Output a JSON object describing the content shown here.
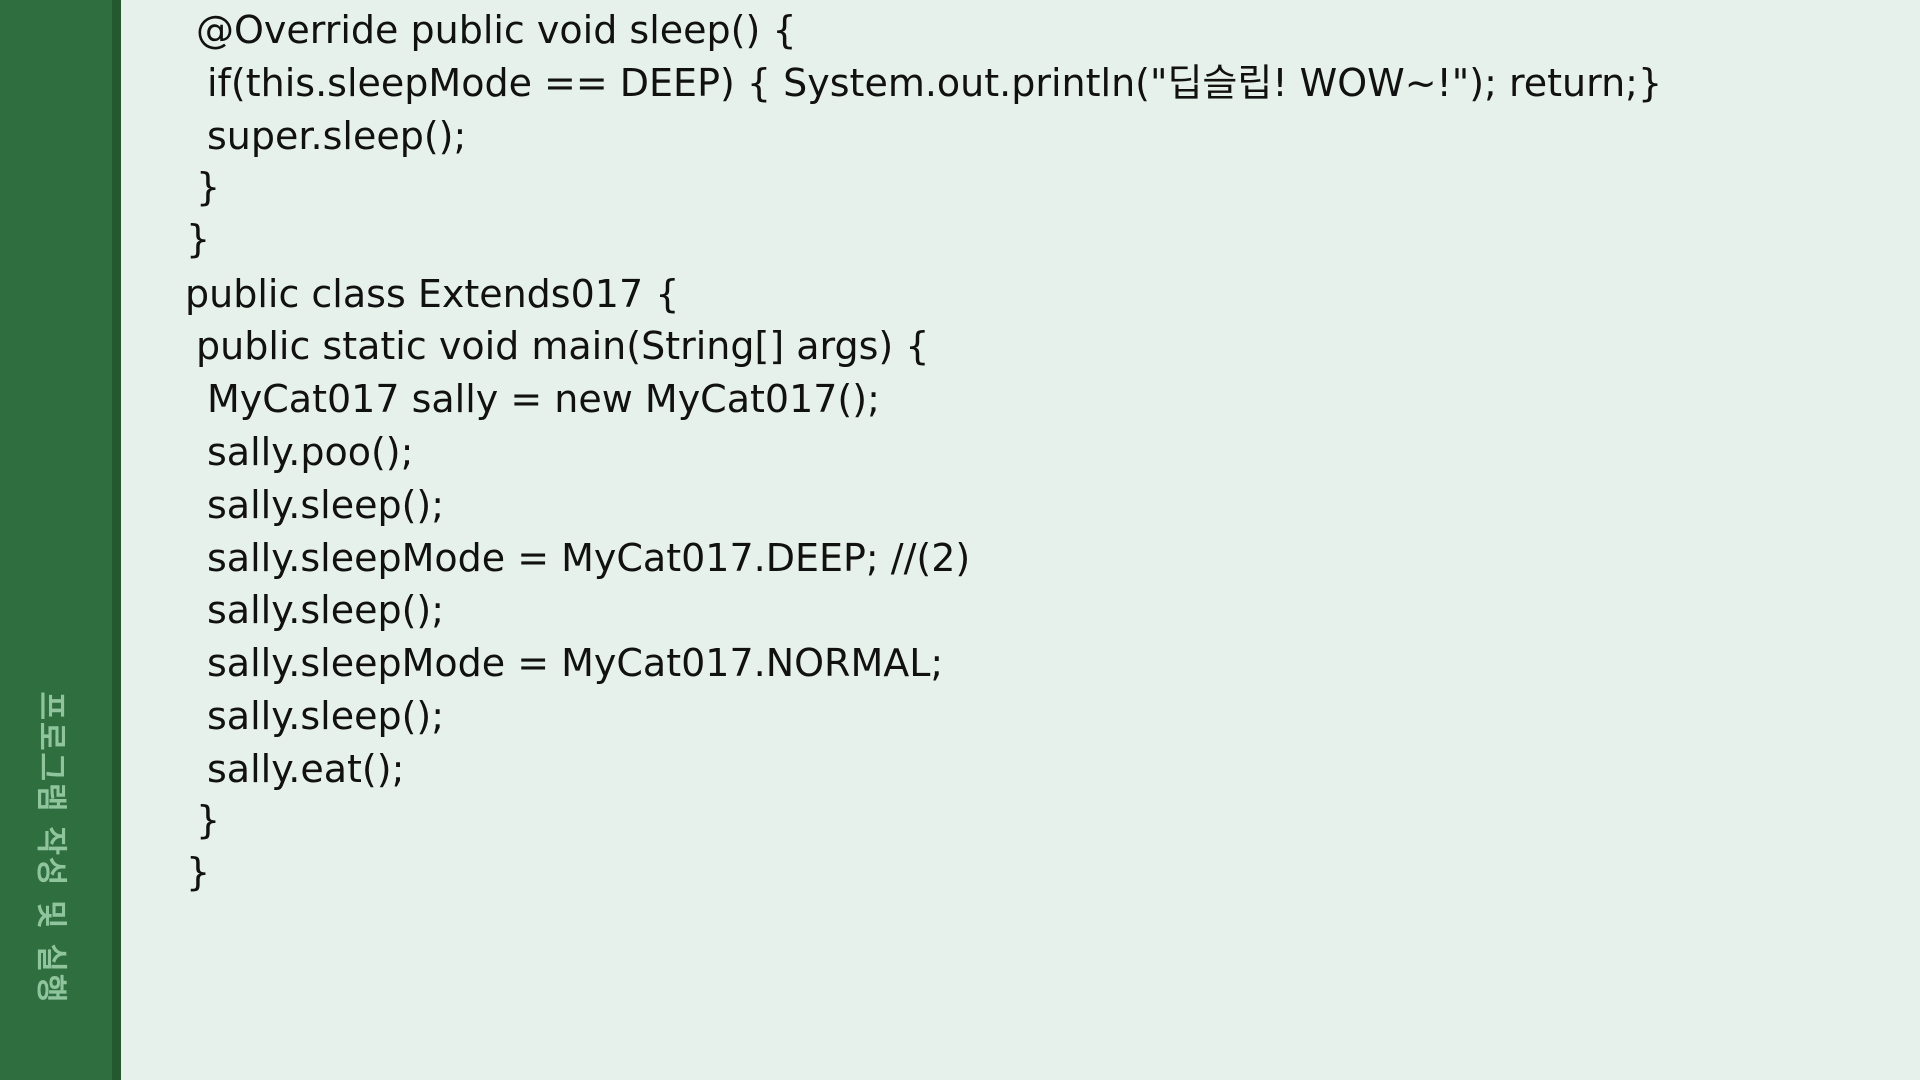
{
  "sidebar": {
    "label": "프로그램 작성 및 실행"
  },
  "code": {
    "lines": [
      "@Override public void sleep() {",
      "if(this.sleepMode == DEEP) { System.out.println(\"딥슬립! WOW~!\"); return;}",
      "super.sleep();",
      "}",
      "}",
      "public class Extends017 {",
      "public static void main(String[] args) {",
      "MyCat017 sally = new MyCat017();",
      "sally.poo();",
      "sally.sleep();",
      "sally.sleepMode = MyCat017.DEEP; //(2)",
      "sally.sleep();",
      "sally.sleepMode = MyCat017.NORMAL;",
      "sally.sleep();",
      "sally.eat();",
      "}",
      "}"
    ]
  },
  "colors": {
    "background": "#e7f1ec",
    "sidebar": "#2f6e3f",
    "sidebar_edge": "#24582f",
    "sidebar_text": "#8fc49c",
    "code_text": "#111111"
  }
}
